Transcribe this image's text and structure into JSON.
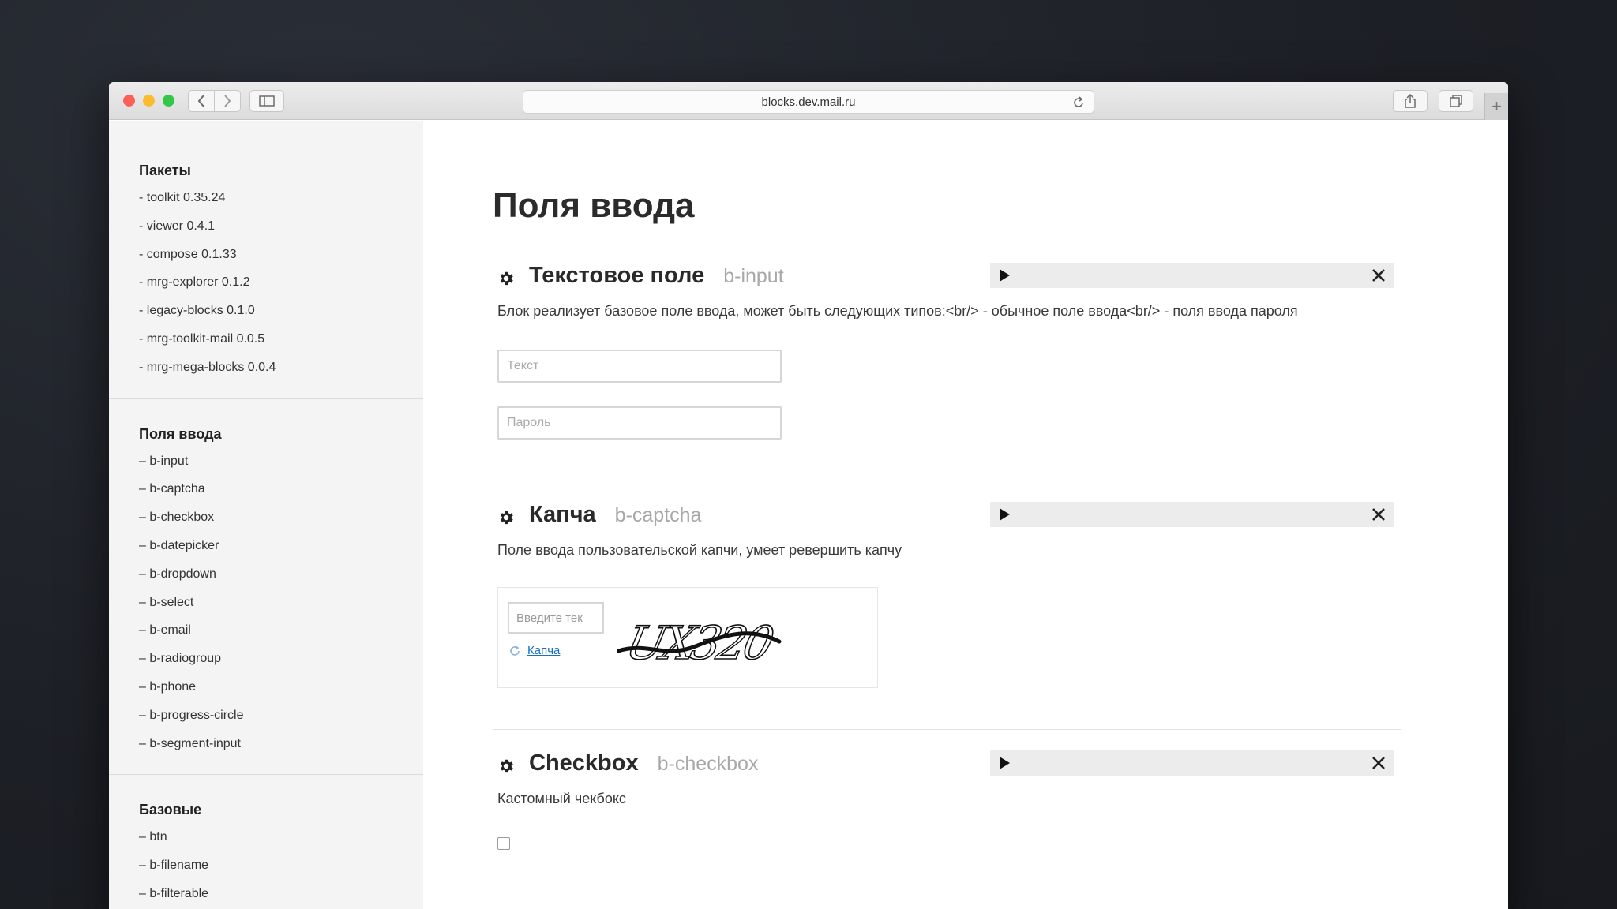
{
  "browser": {
    "url": "blocks.dev.mail.ru"
  },
  "sidebar": {
    "groups": [
      {
        "title": "Пакеты",
        "items": [
          "- toolkit 0.35.24",
          "- viewer 0.4.1",
          "- compose 0.1.33",
          "- mrg-explorer 0.1.2",
          "- legacy-blocks 0.1.0",
          "- mrg-toolkit-mail 0.0.5",
          "- mrg-mega-blocks 0.0.4"
        ]
      },
      {
        "title": "Поля ввода",
        "items": [
          "– b-input",
          "– b-captcha",
          "– b-checkbox",
          "– b-datepicker",
          "– b-dropdown",
          "– b-select",
          "– b-email",
          "– b-radiogroup",
          "– b-phone",
          "– b-progress-circle",
          "– b-segment-input"
        ]
      },
      {
        "title": "Базовые",
        "items": [
          "– btn",
          "– b-filename",
          "– b-filterable"
        ]
      }
    ]
  },
  "main": {
    "title": "Поля ввода",
    "sections": [
      {
        "title": "Текстовое поле",
        "code": "b-input",
        "description": "Блок реализует базовое поле ввода, может быть следующих типов:<br/> - обычное поле ввода<br/> - поля ввода пароля",
        "text_placeholder": "Текст",
        "password_placeholder": "Пароль"
      },
      {
        "title": "Капча",
        "code": "b-captcha",
        "description": "Поле ввода пользовательской капчи, умеет ревершить капчу",
        "input_placeholder": "Введите тек",
        "refresh_link": "Капча",
        "captcha_text": "UX320"
      },
      {
        "title": "Checkbox",
        "code": "b-checkbox",
        "description": "Кастомный чекбокс"
      }
    ]
  }
}
